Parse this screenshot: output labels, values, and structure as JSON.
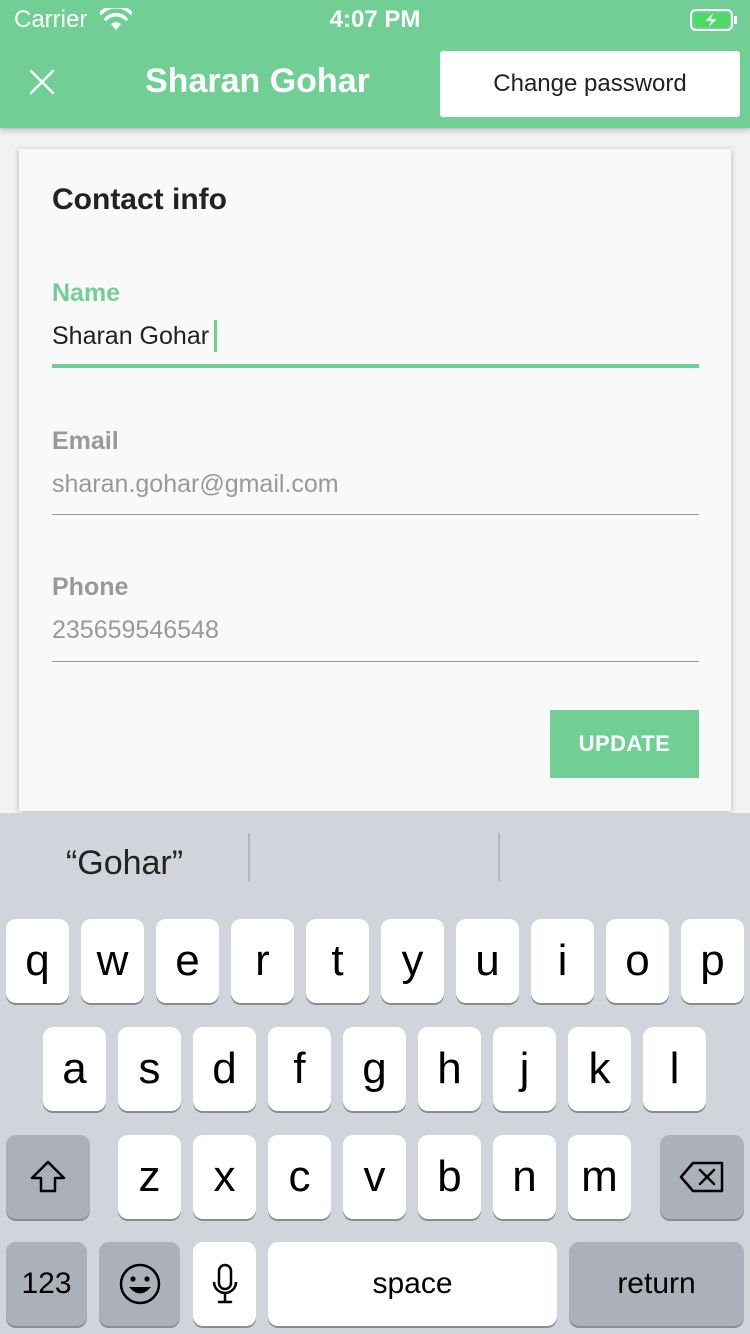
{
  "status": {
    "carrier": "Carrier",
    "time": "4:07 PM"
  },
  "header": {
    "title": "Sharan Gohar",
    "change_password": "Change password"
  },
  "card": {
    "title": "Contact info",
    "fields": [
      {
        "label": "Name",
        "value": "Sharan Gohar"
      },
      {
        "label": "Email",
        "value": "sharan.gohar@gmail.com"
      },
      {
        "label": "Phone",
        "value": "235659546548"
      }
    ],
    "update_label": "UPDATE"
  },
  "keyboard": {
    "suggestions": [
      "“Gohar”",
      "",
      ""
    ],
    "row1": [
      "q",
      "w",
      "e",
      "r",
      "t",
      "y",
      "u",
      "i",
      "o",
      "p"
    ],
    "row2": [
      "a",
      "s",
      "d",
      "f",
      "g",
      "h",
      "j",
      "k",
      "l"
    ],
    "row3": [
      "z",
      "x",
      "c",
      "v",
      "b",
      "n",
      "m"
    ],
    "numbers_label": "123",
    "space_label": "space",
    "return_label": "return"
  },
  "colors": {
    "accent": "#71cf95",
    "keyboard_bg": "#d1d4da"
  },
  "icons": [
    "wifi-icon",
    "battery-charging-icon",
    "close-icon",
    "shift-icon",
    "backspace-icon",
    "emoji-icon",
    "microphone-icon"
  ]
}
